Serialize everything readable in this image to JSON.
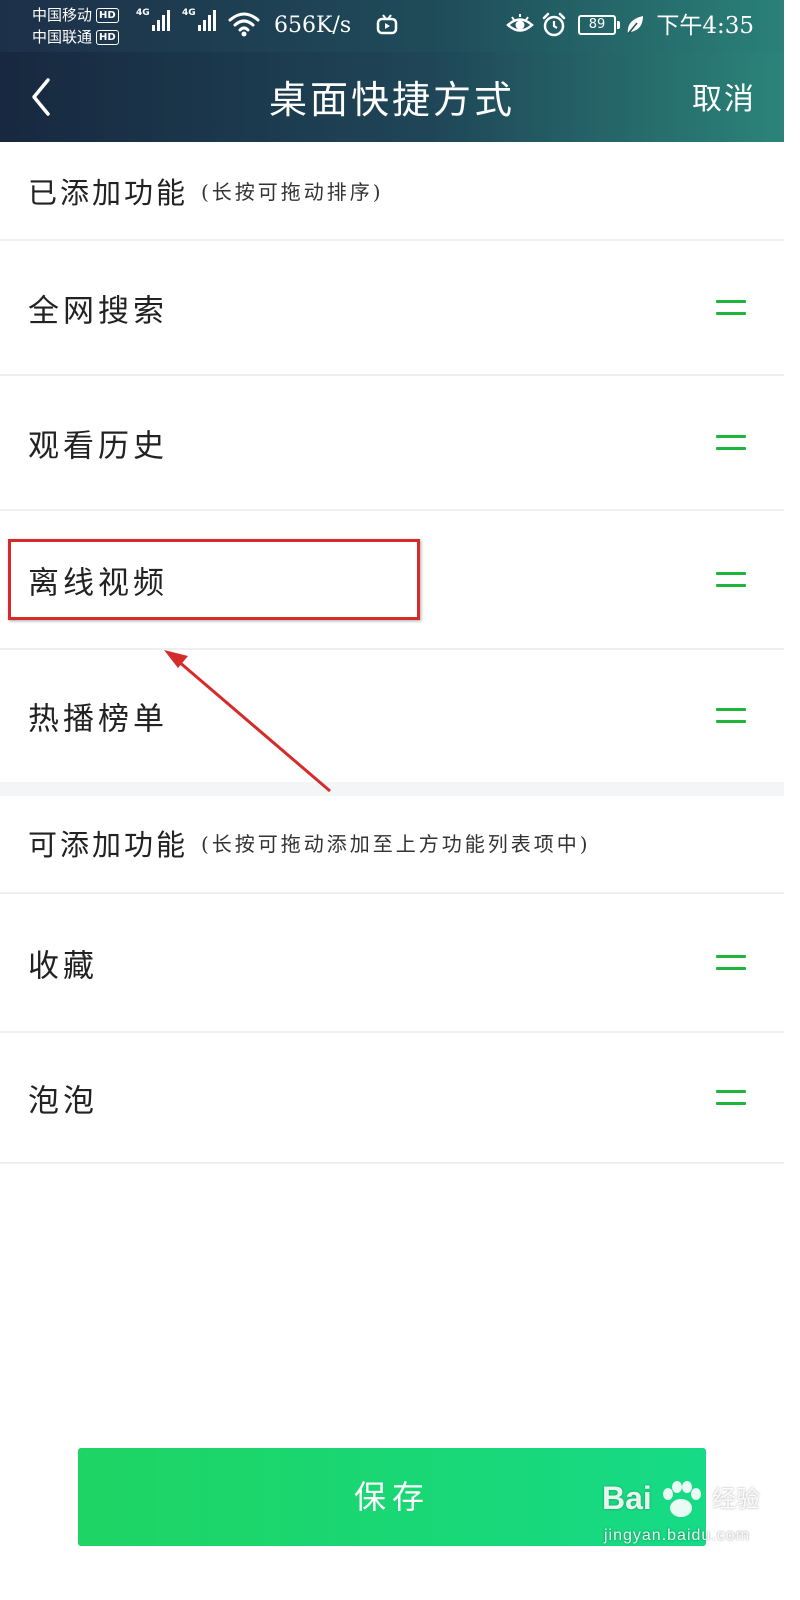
{
  "status_bar": {
    "carrier_1": "中国移动",
    "carrier_2": "中国联通",
    "hd_badge": "HD",
    "network_type": "4G",
    "net_speed": "656K/s",
    "battery_level": "89",
    "time": "下午4:35"
  },
  "header": {
    "title": "桌面快捷方式",
    "cancel_label": "取消"
  },
  "added_section": {
    "title": "已添加功能",
    "hint": "(长按可拖动排序)",
    "items": [
      {
        "label": "全网搜索"
      },
      {
        "label": "观看历史"
      },
      {
        "label": "离线视频"
      },
      {
        "label": "热播榜单"
      }
    ]
  },
  "available_section": {
    "title": "可添加功能",
    "hint": "(长按可拖动添加至上方功能列表项中)",
    "items": [
      {
        "label": "收藏"
      },
      {
        "label": "泡泡"
      }
    ]
  },
  "save_label": "保存",
  "watermark": {
    "logo": "Bai",
    "name": "经验",
    "url": "jingyan.baidu.com"
  },
  "colors": {
    "header_gradient_start": "#17283f",
    "header_gradient_end": "#2b8479",
    "drag_handle": "#1fb53a",
    "save_button": "#1ed463",
    "annotation": "#d62b2b"
  }
}
